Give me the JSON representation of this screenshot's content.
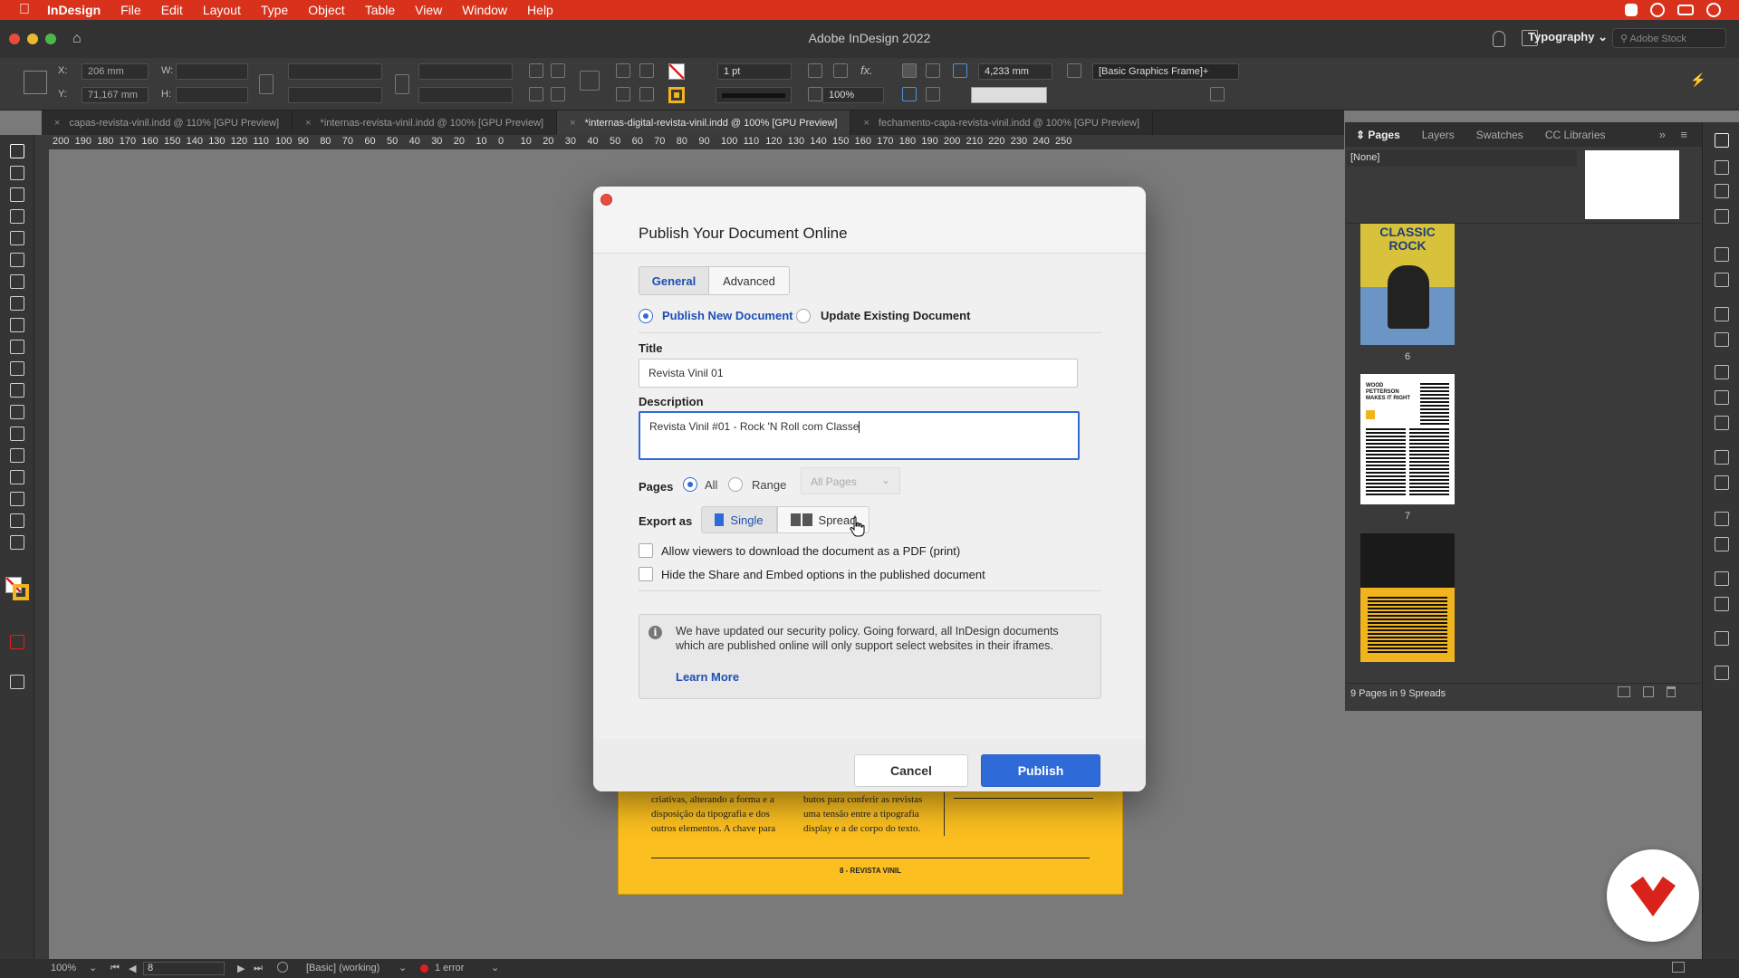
{
  "menubar": {
    "app": "InDesign",
    "items": [
      "File",
      "Edit",
      "Layout",
      "Type",
      "Object",
      "Table",
      "View",
      "Window",
      "Help"
    ]
  },
  "window": {
    "title": "Adobe InDesign 2022",
    "workspace": "Typography",
    "stock_placeholder": "Adobe Stock"
  },
  "control": {
    "x_label": "X:",
    "x_value": "206 mm",
    "y_label": "Y:",
    "y_value": "71,167 mm",
    "w_label": "W:",
    "h_label": "H:",
    "stroke_weight": "1 pt",
    "scale": "100%",
    "gap_value": "4,233 mm",
    "frame_style": "[Basic Graphics Frame]+"
  },
  "tabs": [
    {
      "label": "capas-revista-vinil.indd @ 110% [GPU Preview]"
    },
    {
      "label": "*internas-revista-vinil.indd @ 100% [GPU Preview]"
    },
    {
      "label": "*internas-digital-revista-vinil.indd @ 100% [GPU Preview]",
      "active": true
    },
    {
      "label": "fechamento-capa-revista-vinil.indd @ 100% [GPU Preview]"
    }
  ],
  "ruler": {
    "marks": [
      "200",
      "190",
      "180",
      "170",
      "160",
      "150",
      "140",
      "130",
      "120",
      "110",
      "100",
      "90",
      "80",
      "70",
      "60",
      "50",
      "40",
      "30",
      "20",
      "10",
      "0",
      "10",
      "20",
      "30",
      "40",
      "50",
      "60",
      "70",
      "80",
      "90",
      "100",
      "110",
      "120",
      "130",
      "140",
      "150",
      "160",
      "170",
      "180",
      "190",
      "200",
      "210",
      "220",
      "230",
      "240",
      "250"
    ]
  },
  "document_page": {
    "col1": "criativas, alterando a forma e a disposição da tipografia e dos outros elementos. A chave para",
    "col2": "butos para conferir as revistas uma tensão entre a tipografia display e a de corpo do texto.",
    "footer": "8 - REVISTA VINIL"
  },
  "panel": {
    "tabs": [
      "Pages",
      "Layers",
      "Swatches",
      "CC Libraries"
    ],
    "none_label": "[None]",
    "page_numbers": [
      "6",
      "7"
    ],
    "thumb1_text": "CLASSIC ROCK",
    "thumb2_text": "WOOD PETTERSON MAKES IT RIGHT",
    "summary": "9 Pages in 9 Spreads"
  },
  "status": {
    "zoom": "100%",
    "page": "8",
    "preflight_profile": "[Basic] (working)",
    "errors": "1 error"
  },
  "dialog": {
    "title": "Publish Your Document Online",
    "tab_general": "General",
    "tab_advanced": "Advanced",
    "publish_new": "Publish New Document",
    "update_existing": "Update Existing Document",
    "title_label": "Title",
    "title_value": "Revista Vinil 01",
    "description_label": "Description",
    "description_value": "Revista Vinil #01 - Rock 'N Roll com Classe",
    "pages_label": "Pages",
    "pages_all": "All",
    "pages_range": "Range",
    "pages_select": "All Pages",
    "export_label": "Export as",
    "export_single": "Single",
    "export_spread": "Spread",
    "allow_pdf": "Allow viewers to download the document as a PDF (print)",
    "hide_share": "Hide the Share and Embed options in the published document",
    "notice": "We have updated our security policy. Going forward, all InDesign documents which are published online will only support select websites in their iframes.",
    "learn_more": "Learn More",
    "cancel": "Cancel",
    "publish": "Publish"
  },
  "colors": {
    "menubar": "#d8311c",
    "accent": "#2f6bd8",
    "publish_button": "#2f6bd8",
    "page_yellow": "#fbbf1f"
  }
}
